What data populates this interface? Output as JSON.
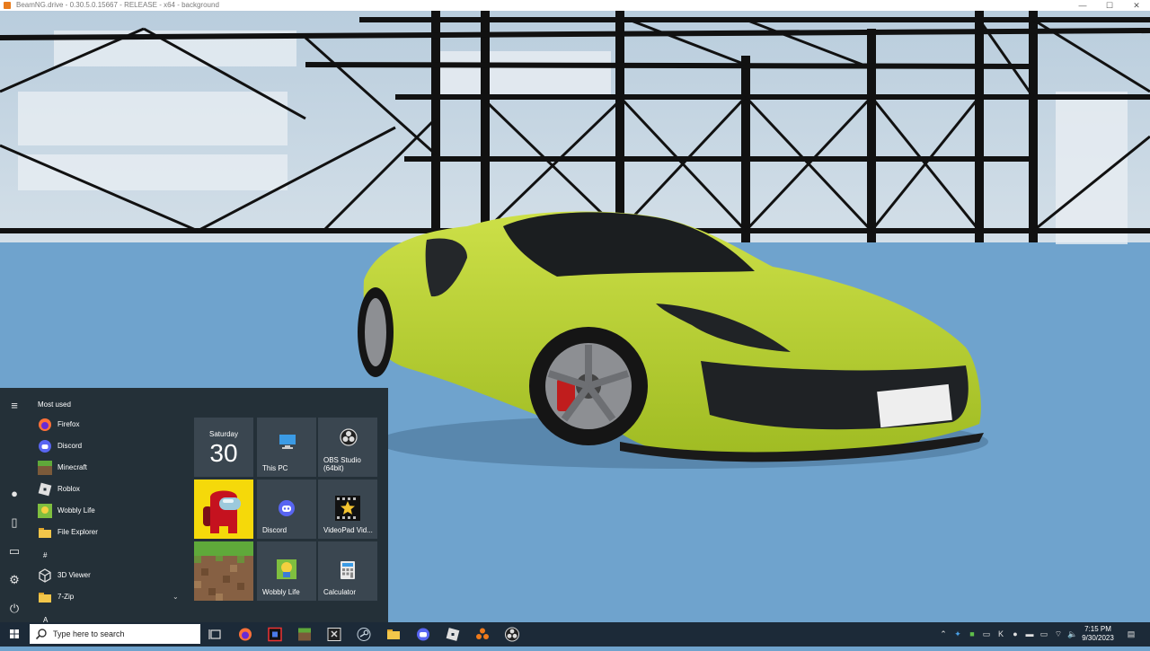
{
  "window": {
    "title": "BeamNG.drive - 0.30.5.0.15667 - RELEASE - x64 - background",
    "minimize_label": "—",
    "maximize_label": "☐",
    "close_label": "✕"
  },
  "start_menu": {
    "most_used_label": "Most used",
    "apps": [
      {
        "label": "Firefox",
        "icon": "firefox-icon"
      },
      {
        "label": "Discord",
        "icon": "discord-icon"
      },
      {
        "label": "Minecraft",
        "icon": "minecraft-icon"
      },
      {
        "label": "Roblox",
        "icon": "roblox-icon"
      },
      {
        "label": "Wobbly Life",
        "icon": "wobbly-life-icon"
      },
      {
        "label": "File Explorer",
        "icon": "folder-icon"
      },
      {
        "label": "3D Viewer",
        "icon": "cube-icon"
      },
      {
        "label": "7-Zip",
        "icon": "folder-icon"
      }
    ],
    "section_hash": "#",
    "section_a": "A",
    "tiles": {
      "calendar_day": "Saturday",
      "calendar_date": "30",
      "this_pc": "This PC",
      "obs": "OBS Studio (64bit)",
      "discord": "Discord",
      "videopad": "VideoPad Vid...",
      "wobbly": "Wobbly Life",
      "calculator": "Calculator"
    }
  },
  "taskbar": {
    "search_placeholder": "Type here to search",
    "clock_time": "7:15 PM",
    "clock_date": "9/30/2023"
  },
  "colors": {
    "car": "#b8d23a",
    "sky": "#c9d9e6",
    "floor": "#6fa3cd",
    "start_bg": "#243038",
    "taskbar_bg": "#1c2a38"
  }
}
